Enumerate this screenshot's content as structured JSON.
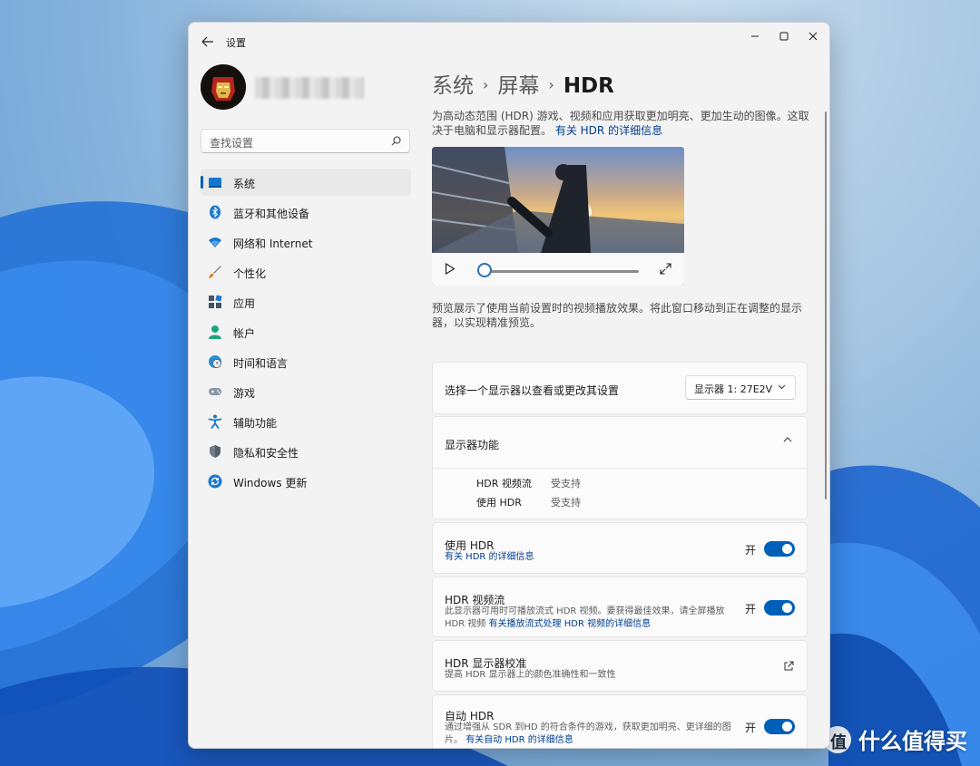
{
  "window": {
    "title": "设置"
  },
  "sidebar": {
    "search_placeholder": "查找设置",
    "items": [
      {
        "label": "系统",
        "icon": "monitor-icon",
        "active": true
      },
      {
        "label": "蓝牙和其他设备",
        "icon": "bluetooth-icon"
      },
      {
        "label": "网络和 Internet",
        "icon": "wifi-icon"
      },
      {
        "label": "个性化",
        "icon": "brush-icon"
      },
      {
        "label": "应用",
        "icon": "apps-icon"
      },
      {
        "label": "帐户",
        "icon": "person-icon"
      },
      {
        "label": "时间和语言",
        "icon": "globe-clock-icon"
      },
      {
        "label": "游戏",
        "icon": "gamepad-icon"
      },
      {
        "label": "辅助功能",
        "icon": "accessibility-icon"
      },
      {
        "label": "隐私和安全性",
        "icon": "shield-icon"
      },
      {
        "label": "Windows 更新",
        "icon": "update-icon"
      }
    ]
  },
  "breadcrumb": {
    "level1": "系统",
    "level2": "屏幕",
    "current": "HDR"
  },
  "intro": {
    "text": "为高动态范围 (HDR) 游戏、视频和应用获取更加明亮、更加生动的图像。这取决于电脑和显示器配置。",
    "link": "有关 HDR 的详细信息"
  },
  "preview_note": "预览展示了使用当前设置时的视频播放效果。将此窗口移动到正在调整的显示器，以实现精准预览。",
  "display_select": {
    "label": "选择一个显示器以查看或更改其设置",
    "value": "显示器 1: 27E2V"
  },
  "capabilities": {
    "title": "显示器功能",
    "rows": [
      {
        "name": "HDR 视频流",
        "value": "受支持"
      },
      {
        "name": "使用 HDR",
        "value": "受支持"
      }
    ]
  },
  "settings": {
    "use_hdr": {
      "title": "使用 HDR",
      "link": "有关 HDR 的详细信息",
      "state": "开",
      "on": true
    },
    "hdr_stream": {
      "title": "HDR 视频流",
      "desc1": "此显示器可用时可播放流式 HDR 视频。要获得最佳效果，请全屏播放",
      "desc2": "HDR 视频",
      "link": "有关播放流式处理 HDR 视频的详细信息",
      "state": "开",
      "on": true
    },
    "calibration": {
      "title": "HDR 显示器校准",
      "desc": "提高 HDR 显示器上的颜色准确性和一致性"
    },
    "auto_hdr": {
      "title": "自动 HDR",
      "desc1": "通过增强从 SDR 到HD 的符合条件的游戏，获取更加明亮、更详细的图",
      "desc2": "片。",
      "link": "有关自动 HDR 的详细信息",
      "state": "开",
      "on": true
    }
  },
  "watermark": {
    "text": "什么值得买",
    "glyph": "值"
  },
  "colors": {
    "accent": "#005fb8",
    "link": "#003e92"
  }
}
